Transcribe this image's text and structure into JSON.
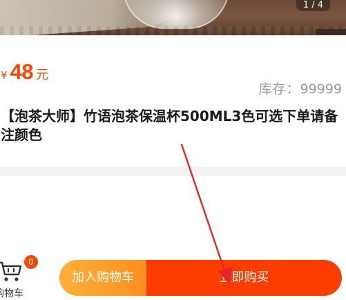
{
  "gallery": {
    "page_indicator": "1 / 4"
  },
  "product": {
    "currency_symbol": "¥",
    "price": "48",
    "price_unit": "元",
    "stock_label": "库存：",
    "stock_value": "99999",
    "title": "【泡茶大师】竹语泡茶保温杯500ML3色可选下单请备注颜色"
  },
  "bottom_bar": {
    "cart_icon": "shopping-cart-icon",
    "cart_label": "购物车",
    "cart_count": "0",
    "add_to_cart_label": "加入购物车",
    "buy_now_label": "立即购买"
  },
  "colors": {
    "price": "#ff4200",
    "add_to_cart": "#ff9a26",
    "buy_now": "#ff3d00",
    "badge": "#ff4400",
    "annotation_arrow": "#e8232a"
  }
}
